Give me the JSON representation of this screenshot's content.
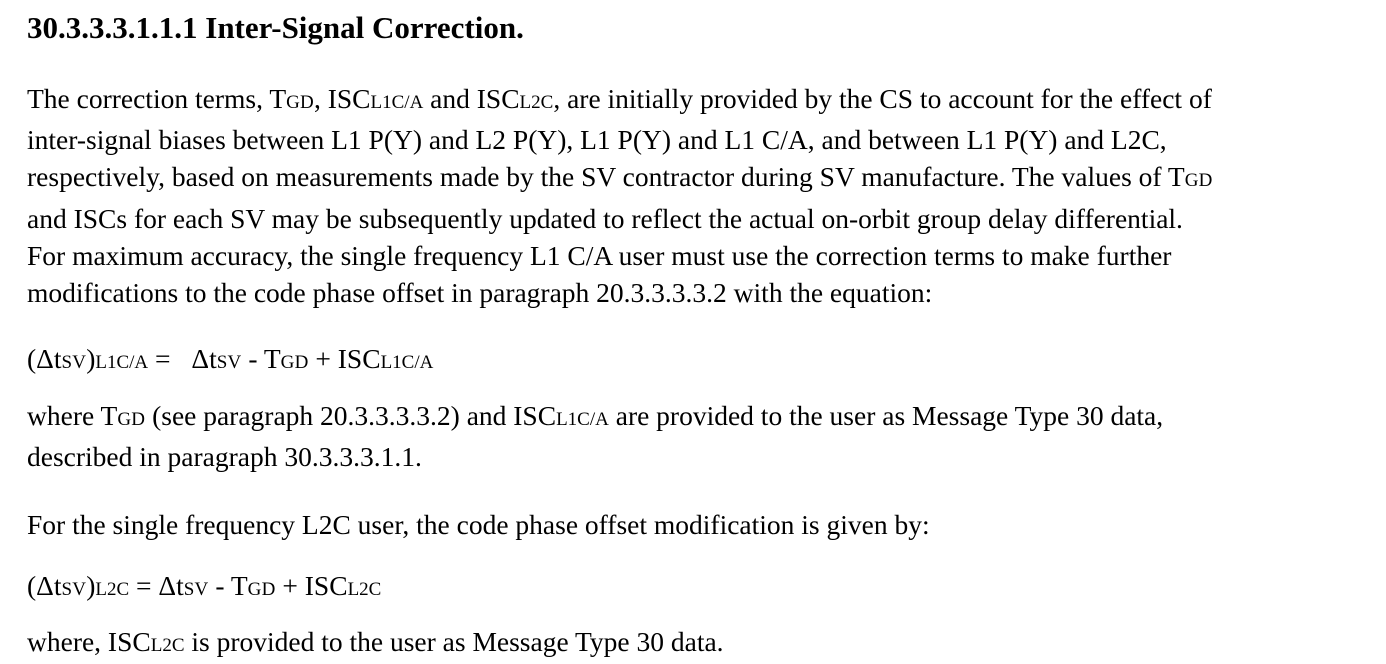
{
  "heading": "30.3.3.3.1.1.1 Inter-Signal Correction.",
  "para1": {
    "l1_a": "The correction terms, T",
    "l1_gd": "GD",
    "l1_b": ", ISC",
    "l1_l1ca": "L1C/A",
    "l1_c": " and ISC",
    "l1_l2c": "L2C",
    "l1_d": ", are initially provided by the CS to account for the effect of",
    "l2": "inter-signal biases between L1 P(Y) and L2 P(Y), L1 P(Y) and L1 C/A, and between L1 P(Y) and L2C,",
    "l3_a": "respectively, based on measurements made by the SV contractor during SV manufacture.  The values of T",
    "l3_gd": "GD",
    "l4": "and ISCs for each SV may be subsequently updated to reflect the actual on-orbit group delay differential.",
    "l5": "For maximum accuracy, the single frequency L1 C/A user must use the correction terms to make further",
    "l6": "modifications to the code phase offset in paragraph 20.3.3.3.3.2 with the equation:"
  },
  "eq1": {
    "lhs_a": "(Δt",
    "lhs_sv": "SV",
    "lhs_b": ")",
    "lhs_sub": "L1C/A",
    "eq": " = ",
    "r_a": "Δt",
    "r_sv": "SV",
    "r_b": "  - T",
    "r_gd": "GD",
    "r_c": " + ISC",
    "r_sub": "L1C/A"
  },
  "para2": {
    "l1_a": "where T",
    "l1_gd": "GD",
    "l1_b": " (see paragraph 20.3.3.3.3.2) and ISC",
    "l1_sub": "L1C/A",
    "l1_c": " are provided to the user as Message Type 30 data,",
    "l2": "described in paragraph 30.3.3.3.1.1."
  },
  "para3": {
    "l1": "For the single frequency L2C user, the code phase offset modification is given by:"
  },
  "eq2": {
    "lhs_a": "(Δt",
    "lhs_sv": "SV",
    "lhs_b": ")",
    "lhs_sub": "L2C",
    "eq": "  =  ",
    "r_a": "Δt",
    "r_sv": "SV",
    "r_b": "  - T",
    "r_gd": "GD",
    "r_c": " + ISC",
    "r_sub": "L2C"
  },
  "para4": {
    "l1_a": "where, ISC",
    "l1_sub": "L2C",
    "l1_b": " is provided to the user as Message Type 30 data."
  }
}
